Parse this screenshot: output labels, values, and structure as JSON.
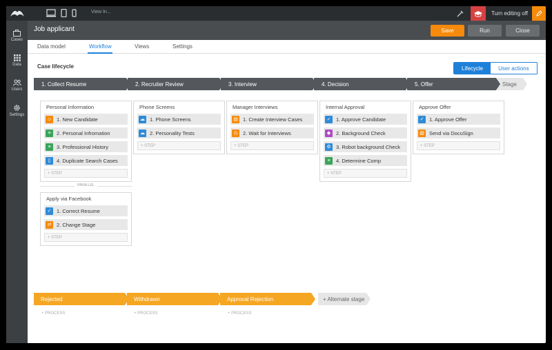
{
  "topbar": {
    "view_in": "View In...",
    "turn_editing_off": "Turn editing off"
  },
  "sidebar": {
    "items": [
      {
        "label": "Cases",
        "icon": "briefcase-icon"
      },
      {
        "label": "Data",
        "icon": "grid-icon"
      },
      {
        "label": "Users",
        "icon": "users-icon"
      },
      {
        "label": "Settings",
        "icon": "gear-icon"
      }
    ]
  },
  "header": {
    "title": "Job applicant",
    "save": "Save",
    "run": "Run",
    "close": "Close"
  },
  "tabs": [
    "Data model",
    "Workflow",
    "Views",
    "Settings"
  ],
  "main": {
    "heading": "Case lifecycle",
    "toggle": {
      "on": "Lifecycle",
      "off": "User actions"
    },
    "stages": [
      "1. Collect Resume",
      "2. Recruiter Review",
      "3. Interview",
      "4. Decision",
      "5. Offer"
    ],
    "add_stage": "Stage",
    "processes": [
      {
        "title": "Personal Information",
        "steps": [
          "1. New Candidate",
          "2. Personal Infromation",
          "3. Professional History",
          "4. Duplicate Search Cases"
        ]
      },
      {
        "title": "Apply via Facebook",
        "steps": [
          "1. Correct Resume",
          "2. Change Stage"
        ]
      },
      {
        "title": "Phone Screens",
        "steps": [
          "1. Phone Screens",
          "2. Personality Tests"
        ]
      },
      {
        "title": "Manager Interviews",
        "steps": [
          "1. Create Interview Cases",
          "2. Wait for Interviews"
        ]
      },
      {
        "title": "Internal Approval",
        "steps": [
          "1. Approve Candidate",
          "2. Background Check",
          "3. Robot background Check",
          "4. Determine Comp"
        ]
      },
      {
        "title": "Approve Offer",
        "steps": [
          "1. Approve Offer",
          "Send via DocuSign"
        ]
      }
    ],
    "add_step": "+ STEP",
    "parallel": "PARALLEL",
    "alt_stages": [
      "Rejected",
      "Withdrawn",
      "Approval Rejection"
    ],
    "add_alt_stage": "+ Alternate stage",
    "add_process": "+ PROCESS"
  },
  "colors": {
    "accent": "#1e80d9",
    "orange": "#f58a0c",
    "alt": "#f5a623",
    "green": "#3aa55a",
    "purple": "#b04ac4",
    "blue": "#2e8bd8"
  }
}
